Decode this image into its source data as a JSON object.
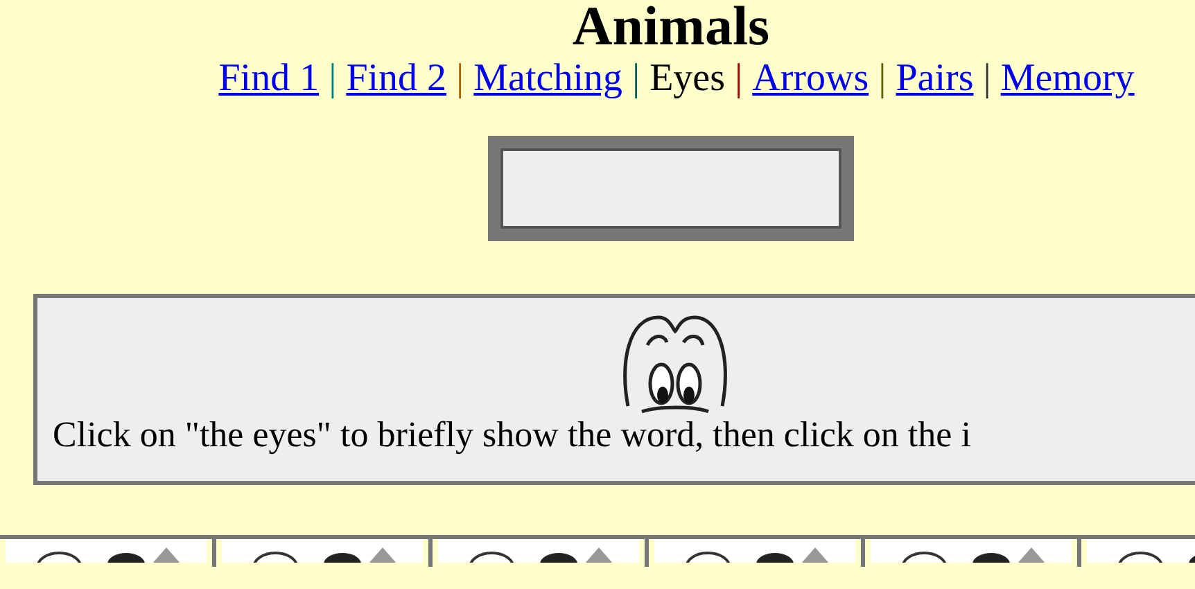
{
  "title": "Animals",
  "nav": [
    {
      "kind": "link",
      "label": "Find 1",
      "selected": false
    },
    {
      "kind": "separator",
      "label": "|",
      "color": "#008080"
    },
    {
      "kind": "link",
      "label": "Find 2",
      "selected": false
    },
    {
      "kind": "separator",
      "label": "|",
      "color": "#b06000"
    },
    {
      "kind": "link",
      "label": "Matching",
      "selected": false
    },
    {
      "kind": "separator",
      "label": "|",
      "color": "#006060"
    },
    {
      "kind": "link",
      "label": "Eyes",
      "selected": true
    },
    {
      "kind": "separator",
      "label": "|",
      "color": "#a00000"
    },
    {
      "kind": "link",
      "label": "Arrows",
      "selected": false
    },
    {
      "kind": "separator",
      "label": "|",
      "color": "#606000"
    },
    {
      "kind": "link",
      "label": "Pairs",
      "selected": false
    },
    {
      "kind": "separator",
      "label": "|",
      "color": "#303030"
    },
    {
      "kind": "link",
      "label": "Memory",
      "selected": false
    }
  ],
  "instructions": "Click on \"the eyes\" to briefly show the word, then click on the i"
}
